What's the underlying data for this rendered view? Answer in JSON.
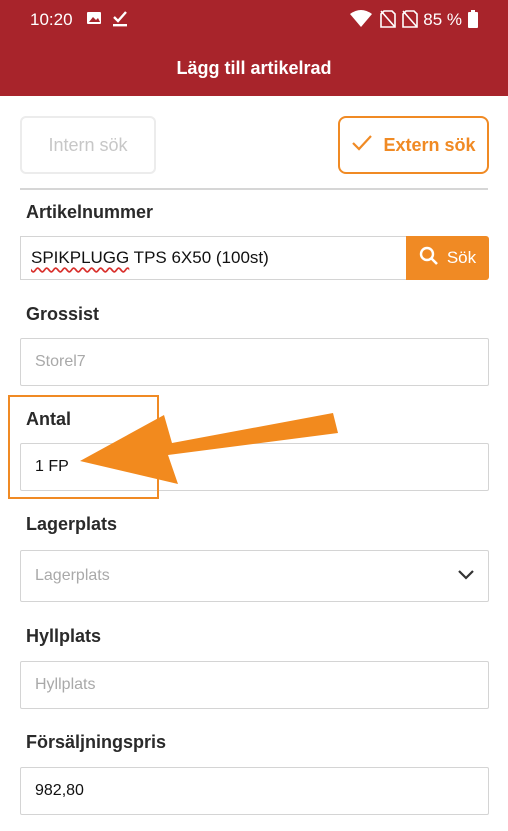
{
  "status_bar": {
    "time": "10:20",
    "battery_percent": "85 %",
    "icons": [
      "image-icon",
      "checkmark-download-icon",
      "wifi-icon",
      "no-sim-icon",
      "no-sim-icon",
      "battery-icon"
    ]
  },
  "app_bar": {
    "title": "Lägg till artikelrad"
  },
  "search_mode": {
    "intern_label": "Intern sök",
    "extern_label": "Extern sök",
    "selected": "Extern sök"
  },
  "article": {
    "label": "Artikelnummer",
    "value_word1": "SPIKPLUGG",
    "value_rest": " TPS 6X50 (100st)",
    "search_button": "Sök"
  },
  "wholesaler": {
    "label": "Grossist",
    "placeholder": "Storel7"
  },
  "quantity": {
    "label": "Antal",
    "value": "1 FP"
  },
  "storage": {
    "label": "Lagerplats",
    "placeholder": "Lagerplats"
  },
  "shelf": {
    "label": "Hyllplats",
    "placeholder": "Hyllplats"
  },
  "price": {
    "label": "Försäljningspris",
    "value": "982,80"
  },
  "colors": {
    "header": "#a8242b",
    "accent": "#f08a24",
    "annotation": "#f28a1e"
  }
}
